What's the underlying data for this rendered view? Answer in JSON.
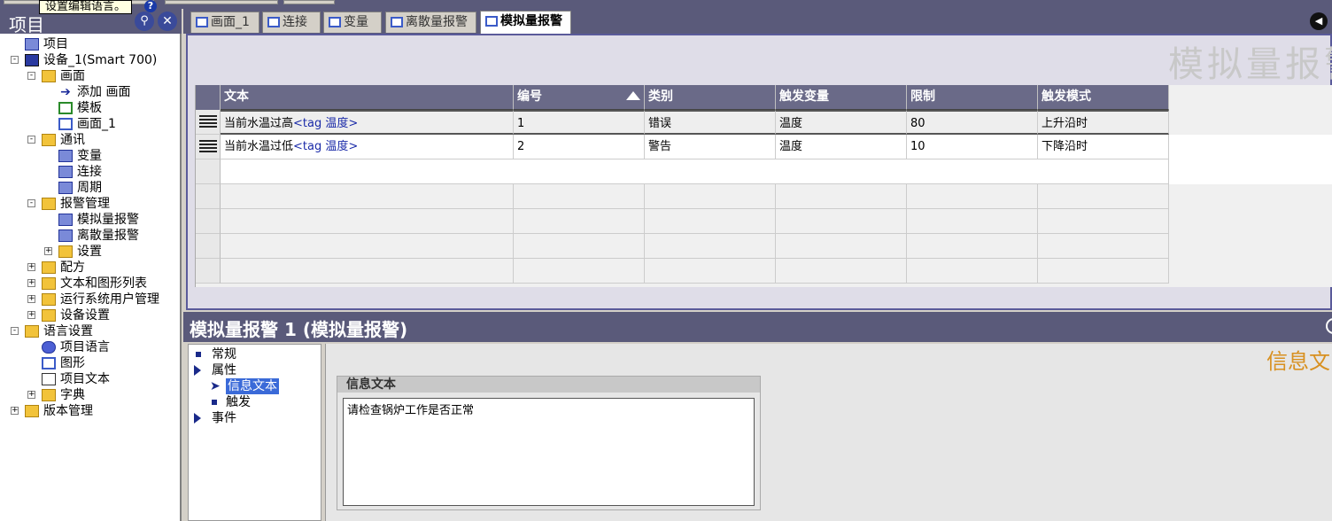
{
  "tooltip": "设置编辑语言。",
  "project_panel": {
    "title": "项目",
    "tree": [
      {
        "label": "项目",
        "level": 0,
        "icon": "project-icon"
      },
      {
        "label": "设备_1(Smart 700)",
        "level": 0,
        "icon": "device-icon",
        "expander": "-"
      },
      {
        "label": "画面",
        "level": 1,
        "icon": "folder-icon",
        "expander": "-"
      },
      {
        "label": "添加 画面",
        "level": 2,
        "icon": "add-arrow-icon"
      },
      {
        "label": "模板",
        "level": 2,
        "icon": "template-icon"
      },
      {
        "label": "画面_1",
        "level": 2,
        "icon": "screen-icon"
      },
      {
        "label": "通讯",
        "level": 1,
        "icon": "folder-icon",
        "expander": "-"
      },
      {
        "label": "变量",
        "level": 2,
        "icon": "tag-icon"
      },
      {
        "label": "连接",
        "level": 2,
        "icon": "connection-icon"
      },
      {
        "label": "周期",
        "level": 2,
        "icon": "cycle-icon"
      },
      {
        "label": "报警管理",
        "level": 1,
        "icon": "folder-icon",
        "expander": "-"
      },
      {
        "label": "模拟量报警",
        "level": 2,
        "icon": "analog-alarm-icon"
      },
      {
        "label": "离散量报警",
        "level": 2,
        "icon": "discrete-alarm-icon"
      },
      {
        "label": "设置",
        "level": 2,
        "icon": "folder-icon",
        "expander": "+"
      },
      {
        "label": "配方",
        "level": 1,
        "icon": "folder-icon",
        "expander": "+"
      },
      {
        "label": "文本和图形列表",
        "level": 1,
        "icon": "folder-icon",
        "expander": "+"
      },
      {
        "label": "运行系统用户管理",
        "level": 1,
        "icon": "folder-icon",
        "expander": "+"
      },
      {
        "label": "设备设置",
        "level": 1,
        "icon": "folder-icon",
        "expander": "+"
      },
      {
        "label": "语言设置",
        "level": 0,
        "icon": "folder-icon",
        "expander": "-"
      },
      {
        "label": "项目语言",
        "level": 1,
        "icon": "globe-icon"
      },
      {
        "label": "图形",
        "level": 1,
        "icon": "graphics-icon"
      },
      {
        "label": "项目文本",
        "level": 1,
        "icon": "document-icon"
      },
      {
        "label": "字典",
        "level": 1,
        "icon": "folder-icon",
        "expander": "+"
      },
      {
        "label": "版本管理",
        "level": 0,
        "icon": "folder-icon",
        "expander": "+"
      }
    ]
  },
  "tabs": [
    {
      "label": "画面_1",
      "active": false
    },
    {
      "label": "连接",
      "active": false
    },
    {
      "label": "变量",
      "active": false
    },
    {
      "label": "离散量报警",
      "active": false
    },
    {
      "label": "模拟量报警",
      "active": true
    }
  ],
  "editor": {
    "big_title": "模拟量报警",
    "columns": [
      "文本",
      "编号",
      "类别",
      "触发变量",
      "限制",
      "触发模式"
    ],
    "rows": [
      {
        "text": "当前水温过高",
        "tag_text": "<tag 温度>",
        "number": "1",
        "class": "错误",
        "trigger_tag": "温度",
        "limit": "80",
        "trigger_mode": "上升沿时",
        "selected": true
      },
      {
        "text": "当前水温过低",
        "tag_text": "<tag 温度>",
        "number": "2",
        "class": "警告",
        "trigger_tag": "温度",
        "limit": "10",
        "trigger_mode": "下降沿时",
        "selected": false
      }
    ]
  },
  "properties": {
    "title": "模拟量报警 1 (模拟量报警)",
    "nav": [
      {
        "label": "常规",
        "type": "bullet"
      },
      {
        "label": "属性",
        "type": "expanded"
      },
      {
        "label": "信息文本",
        "type": "arrow",
        "selected": true
      },
      {
        "label": "触发",
        "type": "bullet"
      },
      {
        "label": "事件",
        "type": "expanded"
      }
    ],
    "content_label": "信息文",
    "group_title": "信息文本",
    "info_text": "请检查锅炉工作是否正常"
  },
  "colors": {
    "title_bar": "#5a5a7a",
    "header": "#6a6a88",
    "selection": "#3a6ad8",
    "accent_label": "#d89020"
  }
}
